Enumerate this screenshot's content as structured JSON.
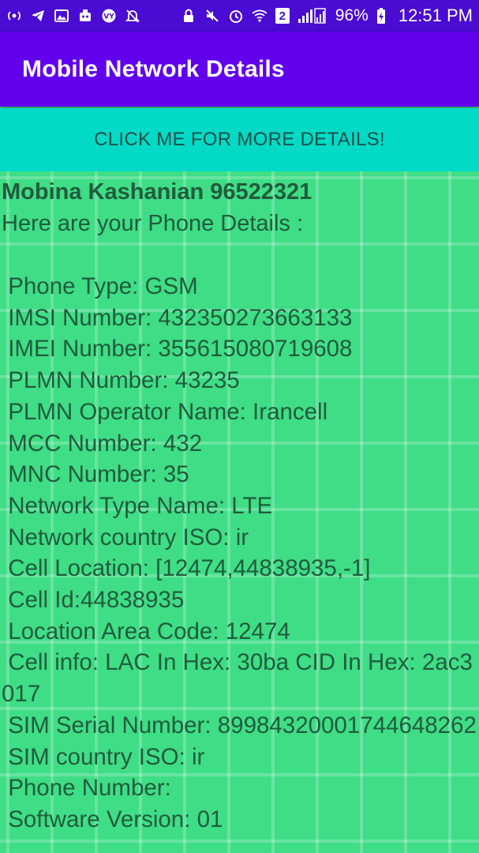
{
  "status_bar": {
    "left_icons": [
      "hotspot-icon",
      "telegram-icon",
      "gallery-icon",
      "robot-icon",
      "vpn-icon",
      "notifications-off-icon"
    ],
    "right_icons": [
      "lock-icon",
      "mute-icon",
      "alarm-icon",
      "wifi-icon",
      "sim2-icon",
      "signal-icon",
      "battery-icon"
    ],
    "sim_label": "2",
    "battery": "96%",
    "time": "12:51 PM",
    "bar_color": "#4a0bd2"
  },
  "app_bar": {
    "title": "Mobile Network Details",
    "color": "#6200ee"
  },
  "button": {
    "label": "CLICK ME FOR MORE DETAILS!",
    "color": "#03dac5"
  },
  "content": {
    "owner": "Mobina Kashanian 96522321",
    "intro": "Here are your Phone Details :",
    "background_color": "#3fdd86",
    "details": [
      " Phone Type: GSM",
      " IMSI Number: 432350273663133",
      " IMEI Number: 355615080719608",
      " PLMN Number: 43235",
      " PLMN Operator Name: Irancell",
      " MCC Number: 432",
      " MNC Number: 35",
      " Network Type Name: LTE",
      " Network country ISO: ir",
      " Cell Location: [12474,44838935,-1]",
      " Cell Id:44838935",
      " Location Area Code: 12474",
      " Cell info: LAC In Hex: 30ba CID In Hex: 2ac3017",
      " SIM Serial Number: 8998432000174464826​2",
      " SIM country ISO: ir",
      " Phone Number:",
      " Software Version: 01"
    ]
  }
}
